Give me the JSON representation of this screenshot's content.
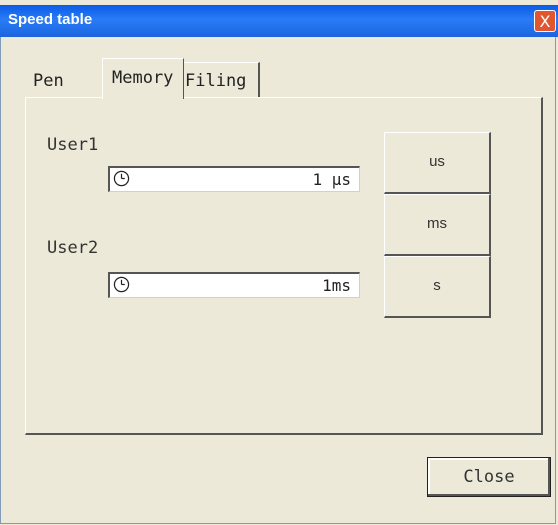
{
  "window": {
    "title": "Speed table",
    "close_glyph": "X"
  },
  "tabs": [
    {
      "label": "Pen",
      "selected": false
    },
    {
      "label": "Memory",
      "selected": true
    },
    {
      "label": "Filing",
      "selected": false
    }
  ],
  "user1": {
    "label": "User1",
    "value": "1 µs",
    "icon": "clock-icon"
  },
  "user2": {
    "label": "User2",
    "value": "1ms",
    "icon": "clock-icon"
  },
  "unit_buttons": {
    "us": "us",
    "ms": "ms",
    "s": "s"
  },
  "footer": {
    "close_label": "Close"
  },
  "colors": {
    "titlebar": "#0a5ae6",
    "close_box": "#e0572f",
    "face": "#ece9d8"
  }
}
